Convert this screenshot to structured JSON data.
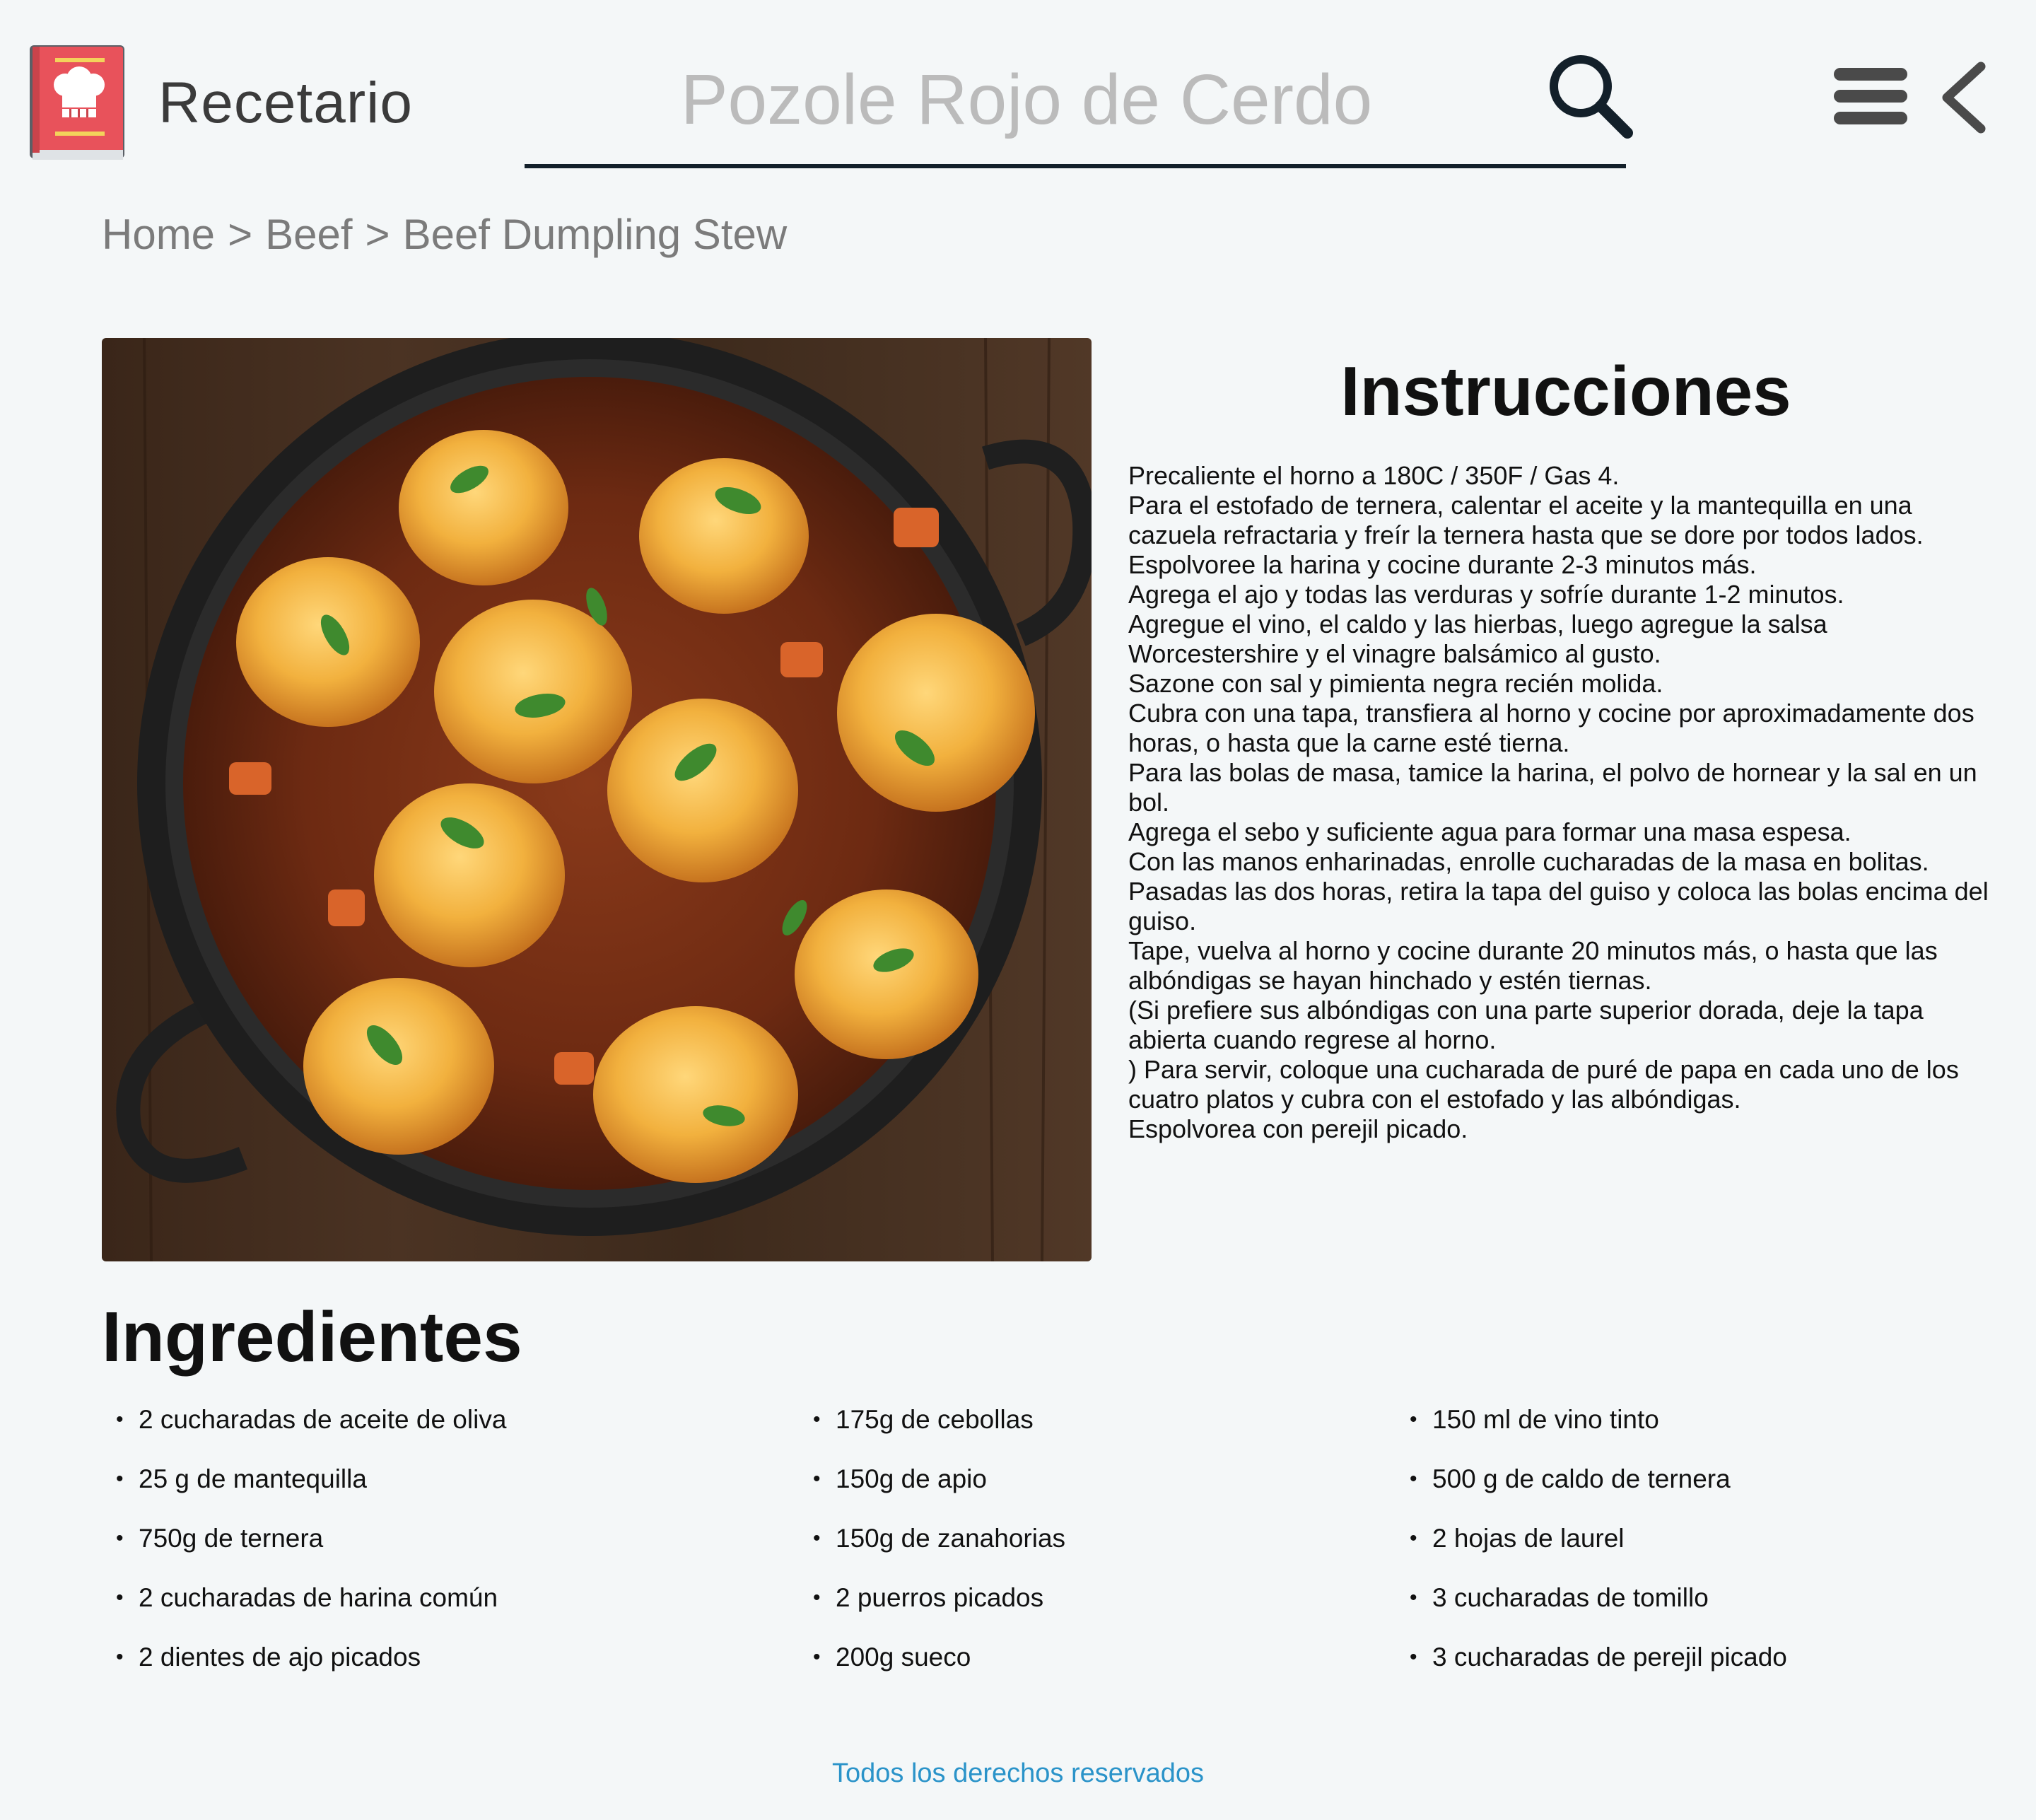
{
  "header": {
    "app_title": "Recetario",
    "search_value": "Pozole Rojo de Cerdo",
    "icons": [
      "cookbook-logo-icon",
      "search-icon",
      "hamburger-menu-icon",
      "chevron-left-icon"
    ]
  },
  "breadcrumb": {
    "items": [
      "Home",
      "Beef",
      "Beef Dumpling Stew"
    ],
    "separator": ">"
  },
  "instructions": {
    "title": "Instrucciones",
    "lines": [
      "Precaliente el horno a 180C / 350F / Gas 4.",
      "Para el estofado de ternera, calentar el aceite y la mantequilla en una cazuela refractaria y freír la ternera hasta que se dore por todos lados.",
      "Espolvoree la harina y cocine durante 2-3 minutos más.",
      "Agrega el ajo y todas las verduras y sofríe durante 1-2 minutos.",
      "Agregue el vino, el caldo y las hierbas, luego agregue la salsa Worcestershire y el vinagre balsámico al gusto.",
      "Sazone con sal y pimienta negra recién molida.",
      "Cubra con una tapa, transfiera al horno y cocine por aproximadamente dos horas, o hasta que la carne esté tierna.",
      "Para las bolas de masa, tamice la harina, el polvo de hornear y la sal en un bol.",
      "Agrega el sebo y suficiente agua para formar una masa espesa.",
      "Con las manos enharinadas, enrolle cucharadas de la masa en bolitas.",
      "Pasadas las dos horas, retira la tapa del guiso y coloca las bolas encima del guiso.",
      "Tape, vuelva al horno y cocine durante 20 minutos más, o hasta que las albóndigas se hayan hinchado y estén tiernas.",
      "(Si prefiere sus albóndigas con una parte superior dorada, deje la tapa abierta cuando regrese al horno.",
      ") Para servir, coloque una cucharada de puré de papa en cada uno de los cuatro platos y cubra con el estofado y las albóndigas.",
      "Espolvorea con perejil picado."
    ]
  },
  "ingredients": {
    "title": "Ingredientes",
    "columns": [
      [
        "2 cucharadas de aceite de oliva",
        "25 g de mantequilla",
        "750g de ternera",
        "2 cucharadas de harina común",
        "2 dientes de ajo picados"
      ],
      [
        "175g de cebollas",
        "150g de apio",
        "150g de zanahorias",
        "2 puerros picados",
        "200g sueco"
      ],
      [
        "150 ml de vino tinto",
        "500 g de caldo de ternera",
        "2 hojas de laurel",
        "3 cucharadas de tomillo",
        "3 cucharadas de perejil picado"
      ]
    ]
  },
  "footer": {
    "text": "Todos los derechos reservados"
  },
  "colors": {
    "background": "#f4f7f8",
    "logo_red": "#e8525b",
    "link_blue": "#2a93c9",
    "search_underline": "#13202a"
  }
}
